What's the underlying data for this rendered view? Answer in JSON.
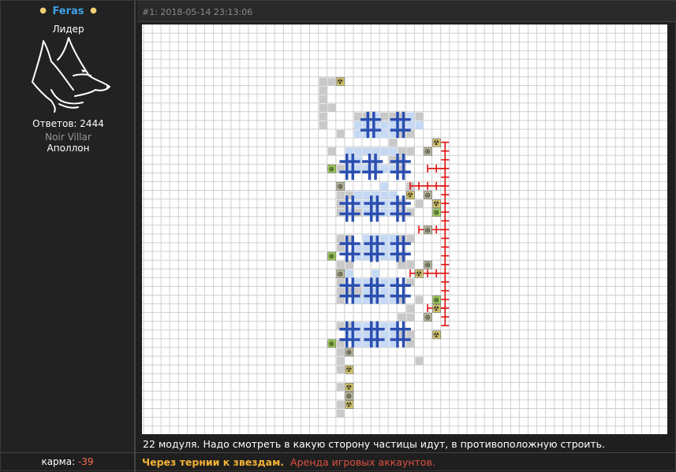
{
  "user": {
    "name": "Feras",
    "rank": "Лидер",
    "replies": "Ответов: 2444",
    "clan": "Noir Villar",
    "server": "Аполлон",
    "avatar_icon": "wolf-head-icon"
  },
  "post": {
    "header": "#1: 2018-05-14 23:13:06",
    "caption": "22 модуля. Надо смотреть в какую сторону частицы идут, в противоположную строить."
  },
  "footer": {
    "karma_label": "карма: ",
    "karma_value": "-39",
    "signature_title": "Через тернии к звездам.",
    "signature_link": "Аренда игровых аккаунтов."
  },
  "colors": {
    "name": "#3da0e6",
    "karma": "#ff6a50",
    "signature_title": "#f2b134",
    "signature_link": "#e05040",
    "grid_line": "#cfcfcf",
    "pipe_blue": "#2b4fb0",
    "wire_red": "#e01010"
  },
  "schematic": {
    "grid": {
      "cols": 60,
      "rows": 46
    },
    "gray": [
      [
        20,
        6
      ],
      [
        21,
        6
      ],
      [
        20,
        7
      ],
      [
        20,
        8
      ],
      [
        20,
        9
      ],
      [
        21,
        9
      ],
      [
        20,
        10
      ],
      [
        24,
        10
      ],
      [
        25,
        10
      ],
      [
        27,
        10
      ],
      [
        28,
        10
      ],
      [
        29,
        10
      ],
      [
        31,
        10
      ],
      [
        20,
        11
      ],
      [
        22,
        12
      ],
      [
        29,
        12
      ],
      [
        30,
        12
      ],
      [
        28,
        13
      ],
      [
        21,
        14
      ],
      [
        29,
        14
      ],
      [
        30,
        14
      ],
      [
        28,
        15
      ],
      [
        29,
        15
      ],
      [
        21,
        16
      ],
      [
        22,
        16
      ],
      [
        29,
        16
      ],
      [
        22,
        18
      ],
      [
        22,
        19
      ],
      [
        22,
        20
      ],
      [
        22,
        21
      ],
      [
        23,
        19
      ],
      [
        24,
        21
      ],
      [
        29,
        21
      ],
      [
        30,
        21
      ],
      [
        30,
        18
      ],
      [
        30,
        19
      ],
      [
        29,
        20
      ],
      [
        31,
        20
      ],
      [
        22,
        24
      ],
      [
        23,
        24
      ],
      [
        29,
        24
      ],
      [
        30,
        24
      ],
      [
        22,
        25
      ],
      [
        29,
        26
      ],
      [
        22,
        27
      ],
      [
        23,
        27
      ],
      [
        29,
        27
      ],
      [
        30,
        27
      ],
      [
        30,
        29
      ],
      [
        22,
        29
      ],
      [
        22,
        30
      ],
      [
        23,
        30
      ],
      [
        24,
        30
      ],
      [
        22,
        31
      ],
      [
        30,
        32
      ],
      [
        31,
        31
      ],
      [
        29,
        31
      ],
      [
        29,
        33
      ],
      [
        30,
        33
      ],
      [
        22,
        34
      ],
      [
        23,
        34
      ],
      [
        29,
        35
      ],
      [
        30,
        35
      ],
      [
        22,
        36
      ],
      [
        30,
        36
      ],
      [
        22,
        37
      ],
      [
        31,
        38
      ],
      [
        22,
        38
      ],
      [
        22,
        39
      ],
      [
        23,
        39
      ],
      [
        22,
        43
      ],
      [
        22,
        44
      ],
      [
        22,
        41
      ]
    ],
    "lightblue": [
      [
        25,
        10
      ],
      [
        26,
        10
      ],
      [
        30,
        10
      ],
      [
        24,
        11
      ],
      [
        25,
        11
      ],
      [
        26,
        11
      ],
      [
        27,
        11
      ],
      [
        28,
        11
      ],
      [
        29,
        11
      ],
      [
        30,
        11
      ],
      [
        31,
        11
      ],
      [
        24,
        12
      ],
      [
        25,
        12
      ],
      [
        26,
        12
      ],
      [
        27,
        12
      ],
      [
        28,
        12
      ],
      [
        23,
        14
      ],
      [
        24,
        14
      ],
      [
        25,
        14
      ],
      [
        26,
        14
      ],
      [
        27,
        14
      ],
      [
        28,
        14
      ],
      [
        23,
        15
      ],
      [
        24,
        15
      ],
      [
        26,
        15
      ],
      [
        28,
        15
      ],
      [
        23,
        16
      ],
      [
        24,
        16
      ],
      [
        25,
        16
      ],
      [
        26,
        16
      ],
      [
        27,
        16
      ],
      [
        28,
        16
      ],
      [
        27,
        18
      ],
      [
        23,
        19
      ],
      [
        24,
        19
      ],
      [
        25,
        19
      ],
      [
        26,
        19
      ],
      [
        27,
        19
      ],
      [
        28,
        19
      ],
      [
        24,
        20
      ],
      [
        25,
        20
      ],
      [
        26,
        20
      ],
      [
        27,
        20
      ],
      [
        28,
        20
      ],
      [
        23,
        21
      ],
      [
        25,
        21
      ],
      [
        26,
        21
      ],
      [
        27,
        21
      ],
      [
        28,
        21
      ],
      [
        25,
        24
      ],
      [
        26,
        24
      ],
      [
        27,
        24
      ],
      [
        28,
        24
      ],
      [
        24,
        25
      ],
      [
        25,
        25
      ],
      [
        26,
        25
      ],
      [
        27,
        25
      ],
      [
        28,
        25
      ],
      [
        24,
        26
      ],
      [
        25,
        26
      ],
      [
        26,
        26
      ],
      [
        27,
        26
      ],
      [
        28,
        26
      ],
      [
        23,
        28
      ],
      [
        26,
        28
      ],
      [
        31,
        28
      ],
      [
        24,
        29
      ],
      [
        25,
        29
      ],
      [
        26,
        29
      ],
      [
        27,
        29
      ],
      [
        28,
        29
      ],
      [
        23,
        30
      ],
      [
        25,
        30
      ],
      [
        26,
        30
      ],
      [
        27,
        30
      ],
      [
        28,
        30
      ],
      [
        24,
        31
      ],
      [
        25,
        31
      ],
      [
        26,
        31
      ],
      [
        27,
        31
      ],
      [
        28,
        31
      ],
      [
        24,
        34
      ],
      [
        25,
        34
      ],
      [
        26,
        34
      ],
      [
        27,
        34
      ],
      [
        28,
        34
      ],
      [
        23,
        35
      ],
      [
        24,
        35
      ],
      [
        25,
        35
      ],
      [
        26,
        35
      ],
      [
        27,
        35
      ],
      [
        28,
        35
      ],
      [
        24,
        36
      ],
      [
        25,
        36
      ],
      [
        26,
        36
      ],
      [
        27,
        36
      ],
      [
        28,
        36
      ]
    ],
    "grids_blue": [
      [
        25,
        10
      ],
      [
        28.4,
        10
      ],
      [
        22.6,
        14.8
      ],
      [
        25.2,
        14.8
      ],
      [
        28.4,
        14.8
      ],
      [
        22.6,
        19.6
      ],
      [
        25.4,
        19.6
      ],
      [
        28.4,
        19.6
      ],
      [
        22.6,
        24.2
      ],
      [
        25.4,
        24.2
      ],
      [
        28.4,
        24.2
      ],
      [
        22.6,
        29
      ],
      [
        25.4,
        29
      ],
      [
        28.4,
        29
      ],
      [
        22.6,
        34
      ],
      [
        25.4,
        34
      ],
      [
        28.4,
        34
      ]
    ],
    "icons_yellow": [
      [
        22,
        6
      ],
      [
        33,
        13
      ],
      [
        30,
        19
      ],
      [
        33,
        20
      ],
      [
        31,
        28
      ],
      [
        33,
        32
      ],
      [
        33,
        35
      ],
      [
        23,
        39
      ],
      [
        23,
        41
      ],
      [
        23,
        43
      ]
    ],
    "icons_green": [
      [
        21,
        16
      ],
      [
        21,
        26
      ],
      [
        21,
        36
      ],
      [
        33,
        21
      ],
      [
        33,
        31
      ]
    ],
    "icons_gray": [
      [
        22,
        18
      ],
      [
        32,
        14
      ],
      [
        32,
        19
      ],
      [
        32,
        23
      ],
      [
        22,
        28
      ],
      [
        32,
        27
      ],
      [
        32,
        33
      ],
      [
        23,
        37
      ],
      [
        23,
        42
      ]
    ],
    "wires": [
      [
        [
          34,
          13
        ],
        [
          34,
          34
        ]
      ],
      [
        [
          30,
          18
        ],
        [
          34,
          18
        ]
      ],
      [
        [
          30,
          28
        ],
        [
          34,
          28
        ]
      ],
      [
        [
          31,
          23
        ],
        [
          34,
          23
        ]
      ],
      [
        [
          32,
          16
        ],
        [
          34,
          16
        ]
      ],
      [
        [
          32,
          32
        ],
        [
          34,
          32
        ]
      ]
    ]
  }
}
